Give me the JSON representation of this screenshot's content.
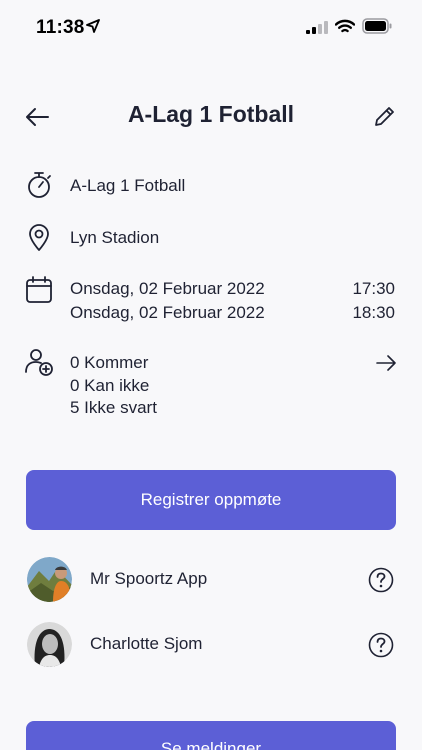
{
  "status_bar": {
    "time": "11:38"
  },
  "header": {
    "title": "A-Lag 1 Fotball"
  },
  "event": {
    "name": "A-Lag 1 Fotball",
    "location": "Lyn Stadion",
    "start_date": "Onsdag, 02 Februar 2022",
    "start_time": "17:30",
    "end_date": "Onsdag, 02 Februar 2022",
    "end_time": "18:30"
  },
  "attendance": {
    "coming": "0 Kommer",
    "cannot": "0 Kan ikke",
    "no_answer": "5 Ikke svart"
  },
  "register_button": "Registrer oppmøte",
  "attendees": [
    {
      "name": "Mr Spoortz App"
    },
    {
      "name": "Charlotte Sjom"
    }
  ],
  "messages_button": "Se meldinger"
}
